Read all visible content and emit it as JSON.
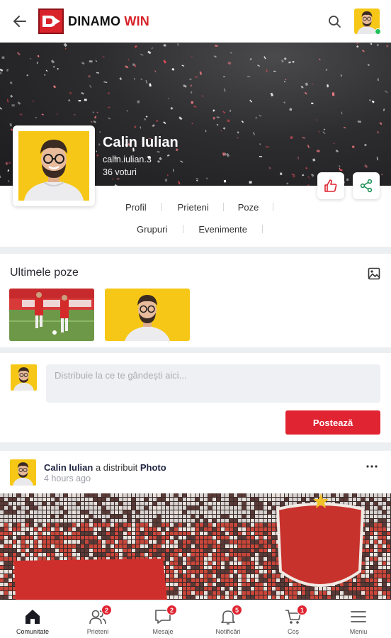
{
  "app": {
    "logo_text_a": "DINAMO",
    "logo_text_b": "WIN",
    "logo_mark_glyph": "D",
    "brand_color": "#d8232a"
  },
  "header": {
    "back_icon": "arrow-left-icon",
    "search_icon": "search-icon"
  },
  "profile": {
    "name": "Calin Iulian",
    "username": "calin.iulian.3",
    "votes": "36 voturi",
    "tabs_row1": [
      "Profil",
      "Prieteni",
      "Poze"
    ],
    "tabs_row2": [
      "Grupuri",
      "Evenimente"
    ]
  },
  "photos": {
    "title": "Ultimele poze"
  },
  "composer": {
    "placeholder": "Distribuie la ce te gândești aici...",
    "submit_label": "Postează"
  },
  "post": {
    "author": "Calin Iulian",
    "action": "a distribuit",
    "object": "Photo",
    "time": "4 hours ago"
  },
  "nav": {
    "items": [
      {
        "label": "Comunitate",
        "icon": "home-icon",
        "badge": ""
      },
      {
        "label": "Prieteni",
        "icon": "friends-icon",
        "badge": "2"
      },
      {
        "label": "Mesaje",
        "icon": "chat-icon",
        "badge": "2"
      },
      {
        "label": "Notificări",
        "icon": "bell-icon",
        "badge": "5"
      },
      {
        "label": "Coș",
        "icon": "cart-icon",
        "badge": "1"
      },
      {
        "label": "Meniu",
        "icon": "menu-icon",
        "badge": ""
      }
    ]
  },
  "colors": {
    "accent": "#e02431",
    "avatar_bg": "#f6c716",
    "online": "#21c15a"
  }
}
